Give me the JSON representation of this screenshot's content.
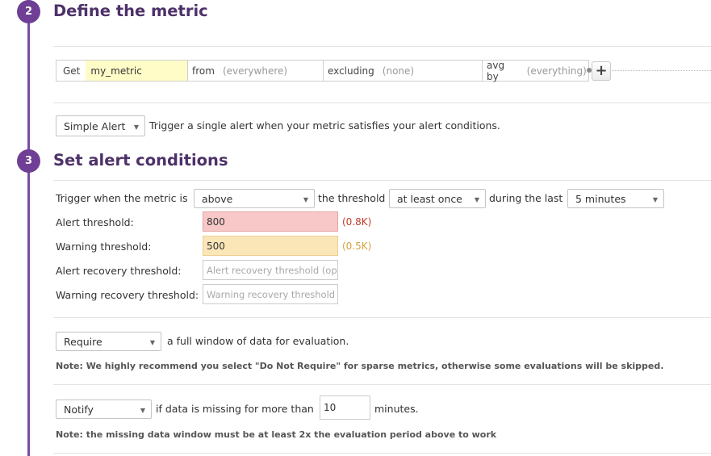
{
  "steps": {
    "define": {
      "number": "2",
      "title": "Define the metric"
    },
    "conditions": {
      "number": "3",
      "title": "Set alert conditions"
    }
  },
  "query": {
    "get_kw": "Get",
    "metric": "my_metric",
    "from_kw": "from",
    "from_val": "(everywhere)",
    "excluding_kw": "excluding",
    "excluding_val": "(none)",
    "avg_kw": "avg by",
    "avg_val": "(everything)",
    "add_label": "+"
  },
  "alert_type": {
    "selected": "Simple Alert",
    "description": "Trigger a single alert when your metric satisfies your alert conditions."
  },
  "conditions": {
    "trigger_prefix": "Trigger when the metric is",
    "comparator": "above",
    "threshold_text": "the threshold",
    "frequency": "at least once",
    "during_text": "during the last",
    "window": "5 minutes",
    "alert_label": "Alert threshold:",
    "alert_value": "800",
    "alert_hint": "(0.8K)",
    "warning_label": "Warning threshold:",
    "warning_value": "500",
    "warning_hint": "(0.5K)",
    "alert_recovery_label": "Alert recovery threshold:",
    "alert_recovery_placeholder": "Alert recovery threshold (op",
    "warning_recovery_label": "Warning recovery threshold:",
    "warning_recovery_placeholder": "Warning recovery threshold"
  },
  "full_window": {
    "selected": "Require",
    "text": "a full window of data for evaluation.",
    "note": "Note: We highly recommend you select \"Do Not Require\" for sparse metrics, otherwise some evaluations will be skipped."
  },
  "missing_data": {
    "selected": "Notify",
    "text": "if data is missing for more than",
    "minutes_value": "10",
    "minutes_label": "minutes.",
    "note": "Note: the missing data window must be at least 2x the evaluation period above to work"
  },
  "colors": {
    "accent": "#6f3f96",
    "alert_bg": "#f8c8c8",
    "warning_bg": "#fbe6b8",
    "alert_hint": "#c0392b",
    "warning_hint": "#d4a23c"
  }
}
